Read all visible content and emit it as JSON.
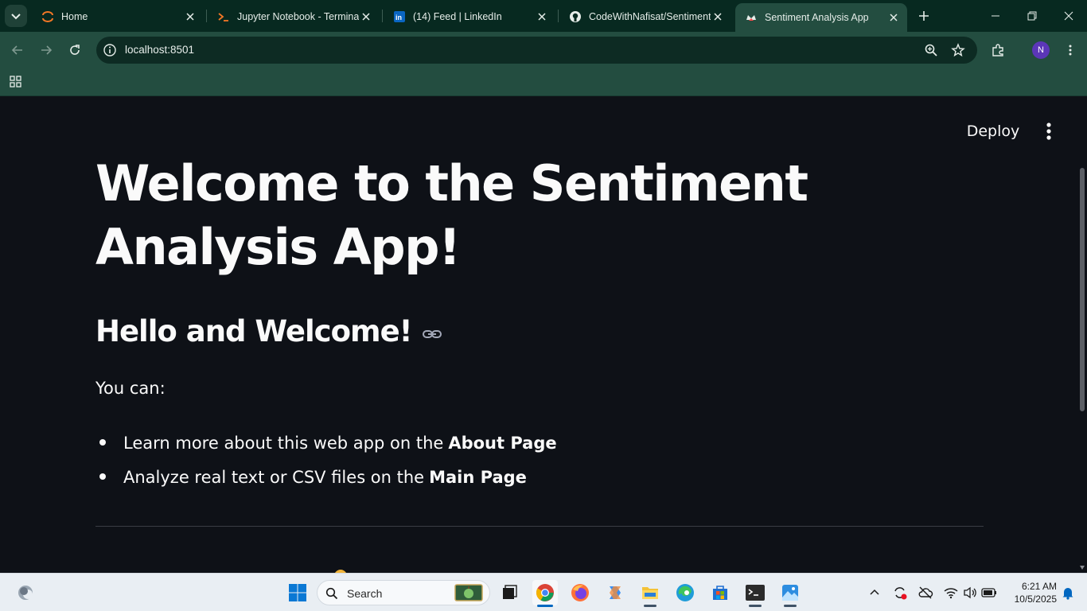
{
  "browser": {
    "tabs": [
      {
        "title": "Home",
        "favicon": "jupyter-icon"
      },
      {
        "title": "Jupyter Notebook - Terminal",
        "favicon": "terminal-icon"
      },
      {
        "title": "(14) Feed | LinkedIn",
        "favicon": "linkedin-icon"
      },
      {
        "title": "CodeWithNafisat/Sentiment",
        "favicon": "github-icon"
      },
      {
        "title": "Sentiment Analysis App",
        "favicon": "streamlit-icon",
        "active": true
      }
    ],
    "url": "localhost:8501",
    "profile_initial": "N",
    "colors": {
      "frame": "#072920",
      "toolbar": "#234d40",
      "omnibox": "#0d2b23"
    }
  },
  "app": {
    "deploy_label": "Deploy",
    "title": "Welcome to the Sentiment Analysis App!",
    "subheader": "Hello and Welcome!",
    "intro": "You can:",
    "bullets": [
      {
        "text": "Learn more about this web app on the",
        "bold": "About Page"
      },
      {
        "text": "Analyze real text or CSV files on the",
        "bold": "Main Page"
      }
    ],
    "colors": {
      "background": "#0e1117",
      "text": "#fafafa"
    }
  },
  "taskbar": {
    "search_placeholder": "Search",
    "time": "6:21 AM",
    "date": "10/5/2025",
    "pinned": [
      "file-explorer-task-view-icon",
      "chrome-icon",
      "firefox-icon",
      "copilot-icon",
      "file-explorer-icon",
      "edge-icon",
      "microsoft-store-icon",
      "terminal-icon",
      "photos-icon"
    ]
  }
}
